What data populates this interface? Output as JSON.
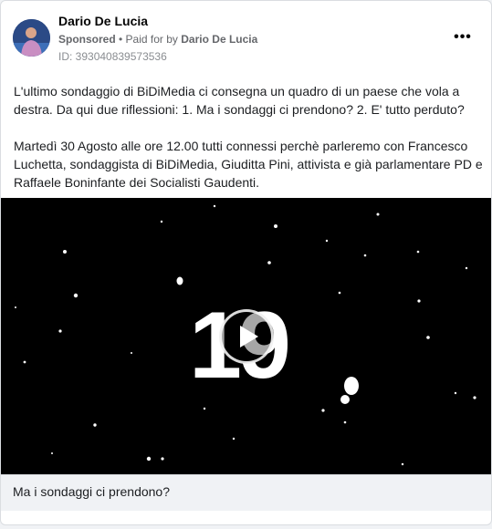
{
  "post": {
    "author_name": "Dario De Lucia",
    "sponsored_label": "Sponsored",
    "paid_for_prefix": "• Paid for by",
    "payer_name": "Dario De Lucia",
    "ad_id": "ID: 393040839573536",
    "more_icon": "more-horizontal-icon",
    "more_label": "•••",
    "paragraph_1": "L'ultimo sondaggio di BiDiMedia ci consegna un quadro di un paese che vola a destra. Da qui due riflessioni: 1. Ma i sondaggi ci prendono? 2. E' tutto perduto?",
    "paragraph_2": "Martedì 30 Agosto alle ore 12.00 tutti connessi perchè parleremo con Francesco Luchetta, sondaggista di BiDiMedia, Giuditta Pini, attivista e già parlamentare PD e Raffaele Boninfante dei Socialisti Gaudenti."
  },
  "video": {
    "overlay_number": "19",
    "play_icon": "play-icon",
    "background_color": "#000000",
    "caption": "Ma i sondaggi ci prendono?"
  },
  "colors": {
    "card_bg": "#ffffff",
    "caption_bg": "#f0f2f5",
    "text_primary": "#050505",
    "text_secondary": "#65676b"
  }
}
